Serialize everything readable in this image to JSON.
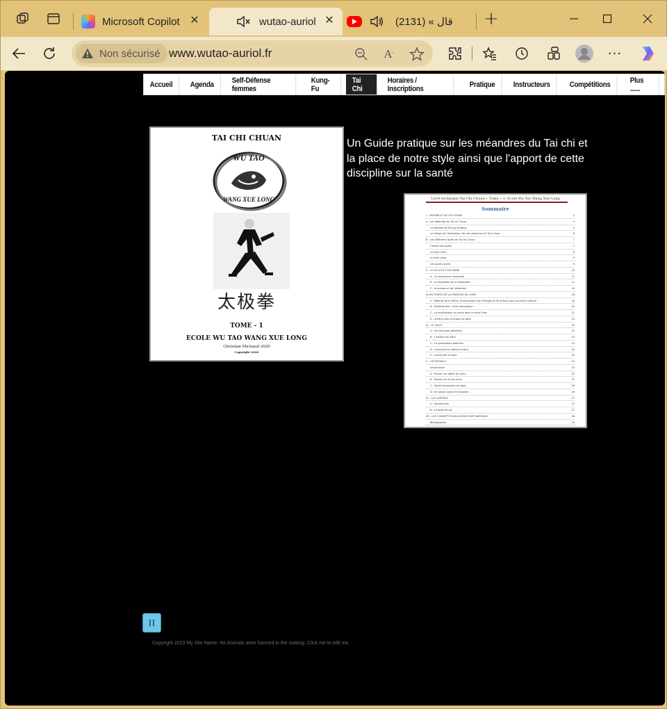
{
  "browser": {
    "tabs": [
      {
        "title": "Microsoft Copilot",
        "active": false
      },
      {
        "title": "wutao-auriol",
        "active": true
      },
      {
        "title": "(2131) « قال",
        "active": false
      }
    ],
    "new_tab": "+",
    "address": {
      "security_label": "Non sécurisé",
      "url": "www.wutao-auriol.fr"
    }
  },
  "site": {
    "nav": [
      {
        "label": "Accueil",
        "active": false
      },
      {
        "label": "Agenda",
        "active": false
      },
      {
        "label": "Self-Défense femmes",
        "active": false
      },
      {
        "label": "Kung-Fu",
        "active": false
      },
      {
        "label": "Tai Chi",
        "active": true
      },
      {
        "label": "Horaires / Inscriptions",
        "active": false
      },
      {
        "label": "Pratique",
        "active": false
      },
      {
        "label": "Instructeurs",
        "active": false
      },
      {
        "label": "Compétitions",
        "active": false
      },
      {
        "label": "Plus ......",
        "active": false
      }
    ],
    "book_cover": {
      "title": "TAI CHI CHUAN",
      "logo_top": "WU TAO",
      "logo_bottom": "WANG XUE LONG",
      "chinese": "太极拳",
      "tome": "TOME - 1",
      "school": "ECOLE WU TAO WANG XUE LONG",
      "author": "Christian Michaud 2020",
      "copyright": "Copyright 2020"
    },
    "description": "Un Guide pratique sur les méandres du Tai chi et la place de notre style ainsi que l'apport de cette discipline sur la santé",
    "toc": {
      "header": "Livre technique Tai Chi Chuan « Tome » 1. Ecole Wu Tao Wang Xue Long",
      "title": "Sommaire",
      "entries": [
        {
          "t": "I – DEFINIR LE TAI CHI CHUAN",
          "p": "2",
          "sub": false
        },
        {
          "t": "A : Les légendes du Tai chi Chuan",
          "p": "4",
          "sub": false
        },
        {
          "t": "La légende de Zhang Sanfeng",
          "p": "4",
          "sub": true
        },
        {
          "t": "Le village de Chenjiagou, lieu de naissance du Tai Ji Quan",
          "p": "6",
          "sub": true
        },
        {
          "t": "B : Les différents styles de Tai chi Chuan",
          "p": "7",
          "sub": false
        },
        {
          "t": "L'arbre des styles",
          "p": "7",
          "sub": true
        },
        {
          "t": "Le style Chen",
          "p": "8",
          "sub": true
        },
        {
          "t": "Le style yang",
          "p": "9",
          "sub": true
        },
        {
          "t": "Les autres styles",
          "p": "9",
          "sub": true
        },
        {
          "t": "II – LE TAI CHI ET SOI-MEME",
          "p": "10",
          "sub": false
        },
        {
          "t": "A : La conscience corporelle",
          "p": "11",
          "sub": true
        },
        {
          "t": "B : La régulation de la respiration",
          "p": "12",
          "sub": true
        },
        {
          "t": "C : la puissance de l'attention",
          "p": "16",
          "sub": true
        },
        {
          "t": "III LES ETAPES DE LA PRATIQUE DU CHEN",
          "p": "18",
          "sub": false
        },
        {
          "t": "A : Maîtrise de la forme, entraînement de l'énergie et de la force sous sa forme externe",
          "p": "18",
          "sub": true
        },
        {
          "t": "B : Système des « trois harmonies »",
          "p": "20",
          "sub": true
        },
        {
          "t": "C : La mobilisation du corps dans le style Chen",
          "p": "21",
          "sub": true
        },
        {
          "t": "D : schéma des principes de base",
          "p": "22",
          "sub": true
        },
        {
          "t": "IV – LE SALUT",
          "p": "23",
          "sub": false
        },
        {
          "t": "A : Les principes généraux",
          "p": "23",
          "sub": true
        },
        {
          "t": "B : L'histoire du salut",
          "p": "23",
          "sub": true
        },
        {
          "t": "C : La symbolique attachée",
          "p": "24",
          "sub": true
        },
        {
          "t": "D : Comment se réalise le salut",
          "p": "24",
          "sub": true
        },
        {
          "t": "E : A quoi sert le salut",
          "p": "24",
          "sub": true
        },
        {
          "t": "V – LES RITUELS",
          "p": "24",
          "sub": false
        },
        {
          "t": "Introduction",
          "p": "24",
          "sub": true
        },
        {
          "t": "A : Placeur en début de cours",
          "p": "25",
          "sub": true
        },
        {
          "t": "B : Placeur en fin de cours",
          "p": "25",
          "sub": true
        },
        {
          "t": "C : Sortie temporaire du tapis",
          "p": "26",
          "sub": true
        },
        {
          "t": "D : Se saluer avant de travailler",
          "p": "26",
          "sub": true
        },
        {
          "t": "VI – LES CHIFFRES",
          "p": "27",
          "sub": false
        },
        {
          "t": "A : Introduction",
          "p": "27",
          "sub": true
        },
        {
          "t": "B : La table de dix",
          "p": "27",
          "sub": true
        },
        {
          "t": "VII – LES CONCEPTS D'UN COURS D'ART MARTIAUX",
          "p": "28",
          "sub": false
        },
        {
          "t": "Bibliographie",
          "p": "29",
          "sub": true
        }
      ]
    },
    "footer": "Copyright 2023 My Site Name. No Animals were harmed in the making. Click me to edit me."
  }
}
